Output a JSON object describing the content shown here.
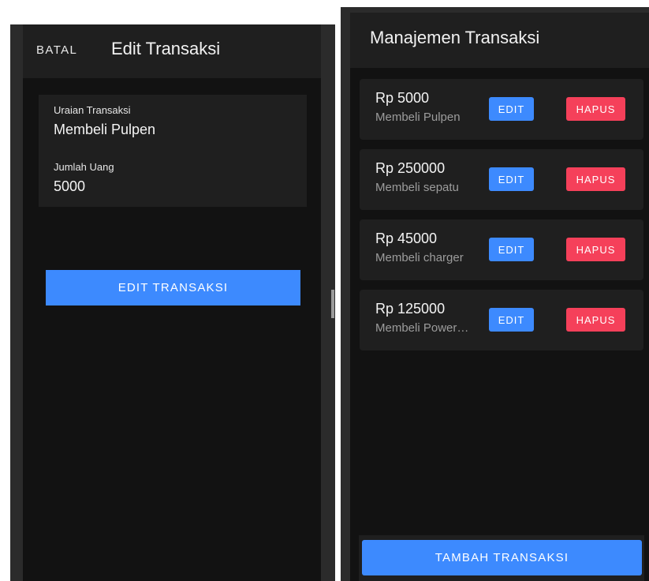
{
  "edit_screen": {
    "cancel_label": "BATAL",
    "title": "Edit Transaksi",
    "fields": {
      "description": {
        "label": "Uraian Transaksi",
        "value": "Membeli Pulpen"
      },
      "amount": {
        "label": "Jumlah Uang",
        "value": "5000"
      }
    },
    "submit_label": "EDIT TRANSAKSI"
  },
  "list_screen": {
    "title": "Manajemen Transaksi",
    "transactions": [
      {
        "amount": "Rp 5000",
        "description": "Membeli Pulpen",
        "edit_label": "EDIT",
        "delete_label": "HAPUS"
      },
      {
        "amount": "Rp 250000",
        "description": "Membeli sepatu",
        "edit_label": "EDIT",
        "delete_label": "HAPUS"
      },
      {
        "amount": "Rp 45000",
        "description": "Membeli charger",
        "edit_label": "EDIT",
        "delete_label": "HAPUS"
      },
      {
        "amount": "Rp 125000",
        "description": "Membeli Power…",
        "edit_label": "EDIT",
        "delete_label": "HAPUS"
      }
    ],
    "add_label": "TAMBAH TRANSAKSI"
  },
  "colors": {
    "primary": "#3d8afe",
    "danger": "#f5405a",
    "surface": "#1f1f1f",
    "background": "#121212"
  }
}
